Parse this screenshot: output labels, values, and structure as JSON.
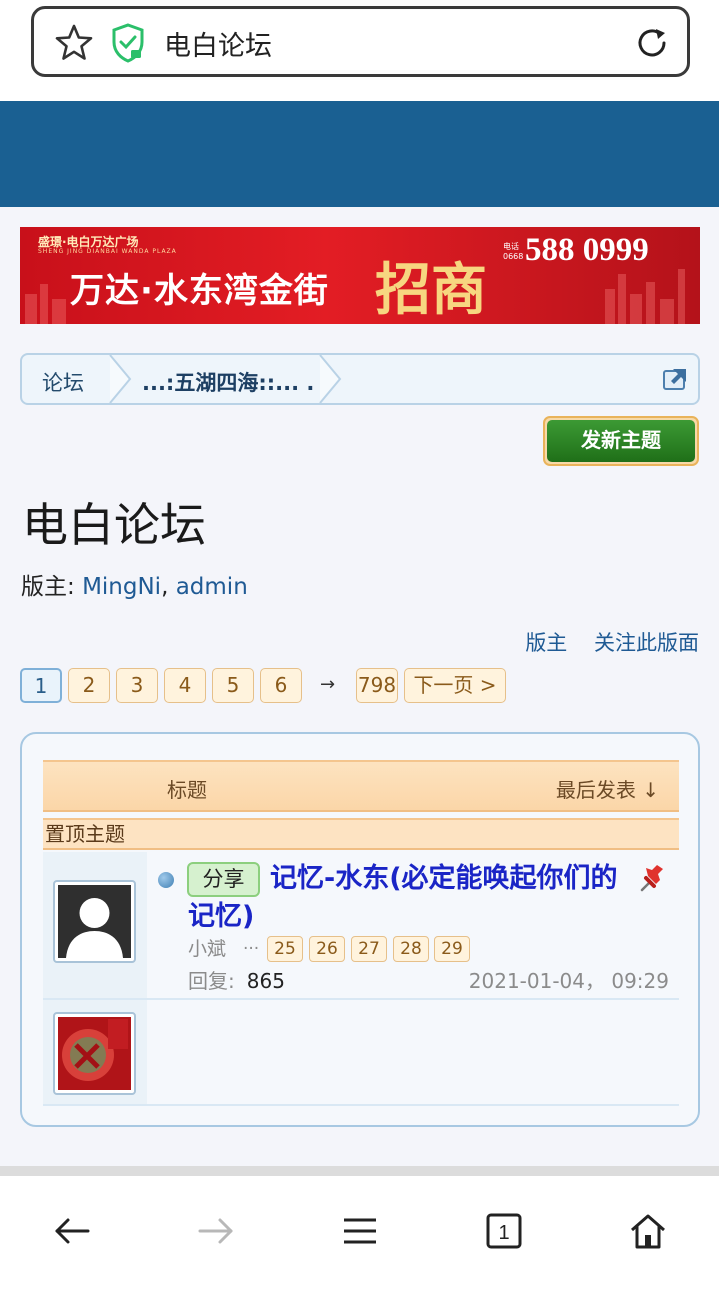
{
  "browser": {
    "url_text": "电白论坛"
  },
  "banner": {
    "top_line": "盛璟·电白万达广场",
    "sub_line": "SHENG JING DIANBAI WANDA PLAZA",
    "main_text": "万达·水东湾金街",
    "big_text": "招商",
    "tel_label": "电话",
    "tel_code": "0668",
    "phone": "588 0999"
  },
  "breadcrumb": {
    "items": [
      "论坛",
      "...:五湖四海::... ."
    ]
  },
  "actions": {
    "new_thread_label": "发新主题"
  },
  "forum": {
    "title": "电白论坛",
    "moderators_label": "版主:",
    "moderators": [
      "MingNi",
      "admin"
    ],
    "links": [
      "版主",
      "关注此版面"
    ]
  },
  "pagination": {
    "pages": [
      "1",
      "2",
      "3",
      "4",
      "5",
      "6"
    ],
    "current": "1",
    "arrow": "→",
    "last": "798",
    "next_label": "下一页 >"
  },
  "thread_list": {
    "col_title": "标题",
    "col_last": "最后发表 ↓",
    "sticky_label": "置顶主题",
    "threads": [
      {
        "tag": "分享",
        "title": "记忆-水东(必定能唤起你们的记忆)",
        "author": "小斌",
        "ellipsis": "...",
        "mini_pages": [
          "25",
          "26",
          "27",
          "28",
          "29"
        ],
        "replies_label": "回复:",
        "replies": "865",
        "last_post": "2021-01-04， 09:29"
      }
    ]
  },
  "colors": {
    "header_blue": "#1a6092",
    "link_blue": "#1f5a94",
    "title_blue": "#1a25c6",
    "button_green": "#2a8524",
    "banner_red": "#e31d24"
  },
  "icons": [
    "star-icon",
    "shield-check-icon",
    "reload-icon",
    "external-link-icon",
    "pin-icon",
    "back-icon",
    "forward-icon",
    "menu-icon",
    "tabs-icon",
    "home-icon"
  ],
  "bottom_nav": {
    "tab_count": "1"
  }
}
